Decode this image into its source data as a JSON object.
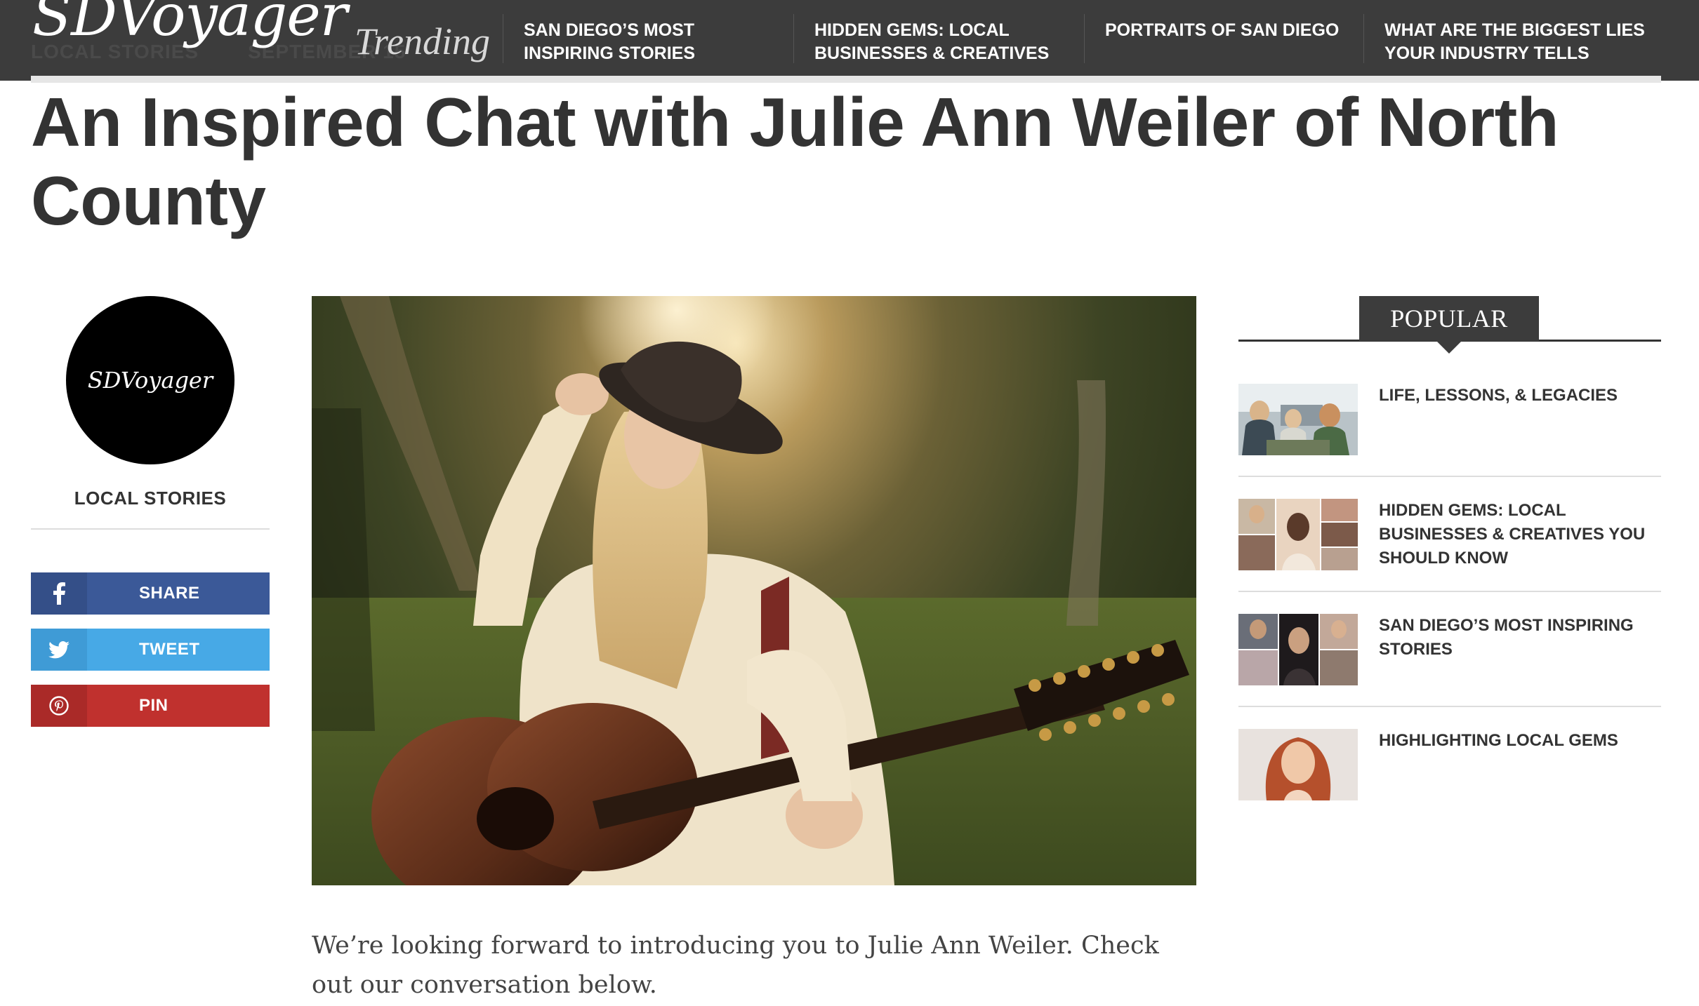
{
  "site": {
    "logo": "SDVoyager",
    "trending_label": "Trending"
  },
  "header_meta": {
    "category": "LOCAL STORIES",
    "date": "SEPTEMBER 15"
  },
  "trending": [
    {
      "label": "SAN DIEGO’S MOST INSPIRING STORIES"
    },
    {
      "label": "HIDDEN GEMS: LOCAL BUSINESSES & CREATIVES"
    },
    {
      "label": "PORTRAITS OF SAN DIEGO"
    },
    {
      "label": "WHAT ARE THE BIGGEST LIES YOUR INDUSTRY TELLS"
    }
  ],
  "article": {
    "title": "An Inspired Chat with Julie Ann Weiler of North County",
    "intro": "We’re looking forward to introducing you to Julie Ann Weiler. Check out our conversation below."
  },
  "author": {
    "avatar_text": "SDVoyager",
    "category": "LOCAL STORIES"
  },
  "share": {
    "facebook": "SHARE",
    "twitter": "TWEET",
    "pinterest": "PIN"
  },
  "colors": {
    "facebook": "#3b5998",
    "twitter": "#47a9e6",
    "pinterest": "#c0312e",
    "topbar": "#3c3c3c"
  },
  "popular": {
    "heading": "POPULAR",
    "items": [
      {
        "title": "LIFE, LESSONS, & LEGACIES"
      },
      {
        "title": "HIDDEN GEMS: LOCAL BUSINESSES & CREATIVES YOU SHOULD KNOW"
      },
      {
        "title": "SAN DIEGO’S MOST INSPIRING STORIES"
      },
      {
        "title": "HIGHLIGHTING LOCAL GEMS"
      }
    ]
  }
}
